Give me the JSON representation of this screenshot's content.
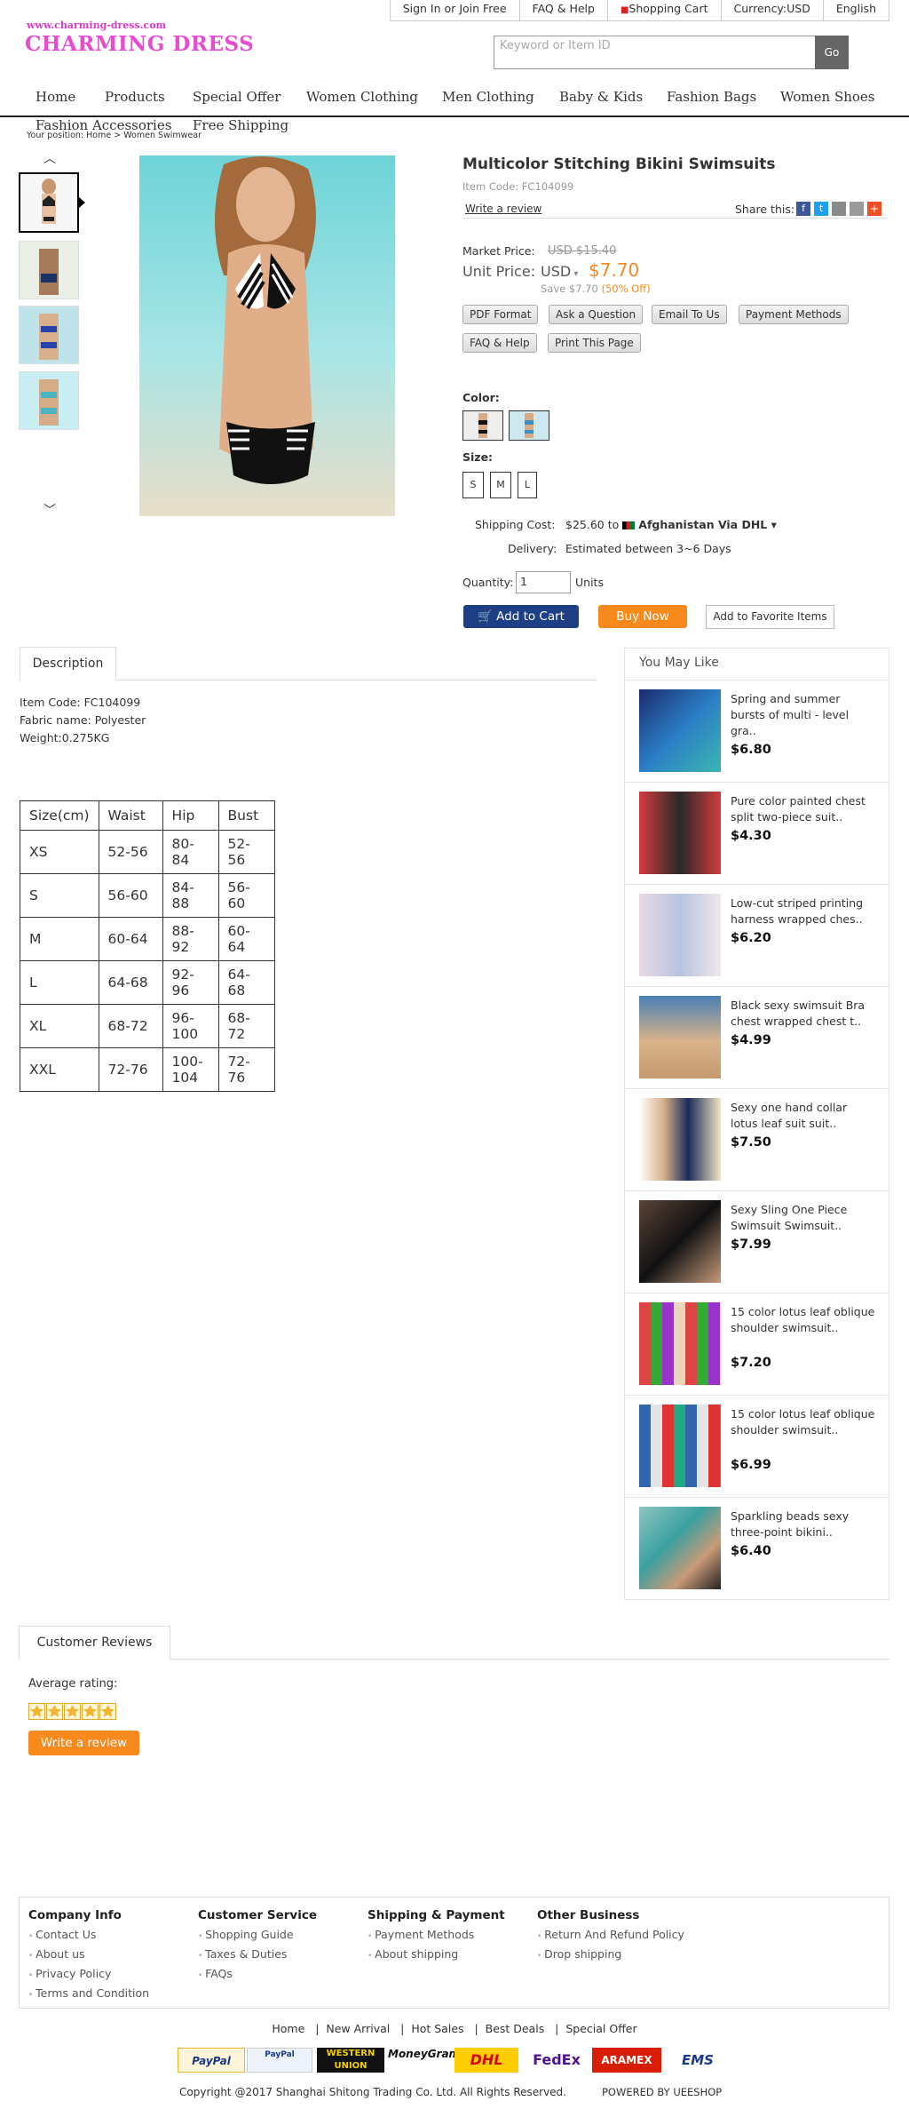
{
  "topbar": {
    "signin": "Sign In",
    "or": "or",
    "join": "Join Free",
    "faq": "FAQ & Help",
    "cart": "Shopping Cart",
    "currency_label": "Currency:",
    "currency_value": "USD",
    "language": "English"
  },
  "logo": {
    "url": "www.charming-dress.com",
    "name": "CHARMING DRESS"
  },
  "search": {
    "placeholder": "Keyword or Item ID",
    "button": "Go"
  },
  "nav": [
    "Home",
    "Products",
    "Special Offer",
    "Women Clothing",
    "Men Clothing",
    "Baby & Kids",
    "Fashion Bags",
    "Women Shoes",
    "Fashion Accessories",
    "Free Shipping"
  ],
  "breadcrumb": "Your position: Home > Women Swimwear",
  "product": {
    "title": "Multicolor Stitching Bikini Swimsuits",
    "item_code": "Item Code: FC104099",
    "write_review": "Write a review",
    "share": "Share this:",
    "market_label": "Market Price:",
    "market_price": "USD $15.40",
    "unit_label": "Unit Price:",
    "unit_currency": "USD",
    "unit_price": "$7.70",
    "save_text": "Save $7.70",
    "save_pct": "(50% Off)",
    "buttons": [
      "PDF Format",
      "Ask a Question",
      "Email To Us",
      "Payment Methods",
      "FAQ & Help",
      "Print This Page"
    ],
    "color_label": "Color:",
    "size_label": "Size:",
    "sizes": [
      "S",
      "M",
      "L"
    ],
    "shipping_label": "Shipping Cost:",
    "shipping_cost": "$25.60",
    "shipping_to": "to",
    "shipping_dest": "Afghanistan Via DHL",
    "delivery_label": "Delivery:",
    "delivery_value": "Estimated between 3~6 Days",
    "quantity_label": "Quantity:",
    "quantity": "1",
    "units": "Units",
    "add_to_cart": "Add to Cart",
    "buy_now": "Buy Now",
    "favorite": "Add to Favorite Items"
  },
  "description": {
    "tab": "Description",
    "lines": [
      "Item Code: FC104099",
      "Fabric name: Polyester",
      "Weight:0.275KG"
    ],
    "table": [
      [
        "Size(cm)",
        "Waist",
        "Hip",
        "Bust"
      ],
      [
        "XS",
        "52-56",
        "80-84",
        "52-56"
      ],
      [
        "S",
        "56-60",
        "84-88",
        "56-60"
      ],
      [
        "M",
        "60-64",
        "88-92",
        "60-64"
      ],
      [
        "L",
        "64-68",
        "92-96",
        "64-68"
      ],
      [
        "XL",
        "68-72",
        "96-100",
        "68-72"
      ],
      [
        "XXL",
        "72-76",
        "100-104",
        "72-76"
      ]
    ]
  },
  "you_may_like": {
    "title": "You May Like",
    "items": [
      {
        "name": "Spring and summer bursts of multi - level gra..",
        "price": "$6.80"
      },
      {
        "name": "Pure color painted chest split two-piece suit..",
        "price": "$4.30"
      },
      {
        "name": "Low-cut striped printing harness wrapped ches..",
        "price": "$6.20"
      },
      {
        "name": "Black sexy swimsuit Bra chest wrapped chest t..",
        "price": "$4.99"
      },
      {
        "name": "Sexy one hand collar lotus leaf suit suit..",
        "price": "$7.50"
      },
      {
        "name": "Sexy Sling One Piece Swimsuit Swimsuit..",
        "price": "$7.99"
      },
      {
        "name": "15 color lotus leaf oblique shoulder swimsuit..",
        "price": "$7.20"
      },
      {
        "name": "15 color lotus leaf oblique shoulder swimsuit..",
        "price": "$6.99"
      },
      {
        "name": "Sparkling beads sexy three-point bikini..",
        "price": "$6.40"
      }
    ]
  },
  "reviews": {
    "tab": "Customer Reviews",
    "avg_label": "Average rating:",
    "write": "Write a review"
  },
  "footer": {
    "cols": [
      {
        "title": "Company Info",
        "links": [
          "Contact Us",
          "About us",
          "Privacy Policy",
          "Terms and Condition"
        ]
      },
      {
        "title": "Customer Service",
        "links": [
          "Shopping Guide",
          "Taxes & Duties",
          "FAQs"
        ]
      },
      {
        "title": "Shipping & Payment",
        "links": [
          "Payment Methods",
          "About shipping"
        ]
      },
      {
        "title": "Other Business",
        "links": [
          "Return And Refund Policy",
          "Drop shipping"
        ]
      }
    ],
    "bottom_links": [
      "Home",
      "New Arrival",
      "Hot Sales",
      "Best Deals",
      "Special Offer"
    ],
    "payment_logos": [
      "PayPal",
      "PayPal",
      "WESTERN UNION",
      "MoneyGram",
      "DHL",
      "FedEx",
      "ARAMEX",
      "EMS"
    ],
    "copyright": "Copyright @2017 Shanghai Shitong Trading Co. Ltd. All Rights Reserved.",
    "powered": "POWERED BY UEESHOP"
  },
  "colors": {
    "accent_orange": "#f7891d",
    "nav_blue": "#1f3f84",
    "logo_pink": "#e74bd0"
  }
}
